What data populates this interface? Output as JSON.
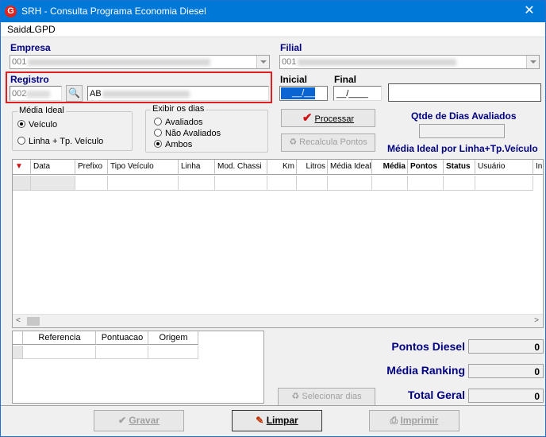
{
  "window": {
    "title": "SRH - Consulta Programa Economia Diesel",
    "close": "✕"
  },
  "menu": [
    "Saida",
    "LGPD"
  ],
  "empresa": {
    "label": "Empresa",
    "code": "001"
  },
  "filial": {
    "label": "Filial",
    "code": "001"
  },
  "registro": {
    "label": "Registro",
    "code": "002",
    "name": "AB"
  },
  "inicial": {
    "label": "Inicial",
    "value": "__/____"
  },
  "final": {
    "label": "Final",
    "value": "__/____"
  },
  "media_ideal": {
    "title": "Média Ideal",
    "options": [
      "Veículo",
      "Linha + Tp. Veículo"
    ],
    "selected": 0
  },
  "exibir": {
    "title": "Exibir os dias",
    "options": [
      "Avaliados",
      "Não Avaliados",
      "Ambos"
    ],
    "selected": 2
  },
  "buttons": {
    "processar": "Processar",
    "recalcula": "Recalcula Pontos",
    "selecionar": "Selecionar dias",
    "gravar": "Gravar",
    "limpar": "Limpar",
    "imprimir": "Imprimir"
  },
  "qtde_label": "Qtde de Dias Avaliados",
  "media_linha_label": "Média Ideal por Linha+Tp.Veículo",
  "grid_columns": [
    "Data",
    "Prefixo",
    "Tipo Veículo",
    "Linha",
    "Mod. Chassi",
    "Km",
    "Litros",
    "Média Ideal",
    "Média",
    "Pontos",
    "Status",
    "Usuário",
    "In"
  ],
  "sub_grid_columns": [
    "Referencia",
    "Pontuacao",
    "Origem"
  ],
  "totals": {
    "pontos_label": "Pontos Diesel",
    "pontos": "0",
    "ranking_label": "Média Ranking",
    "ranking": "0",
    "total_label": "Total Geral",
    "total": "0"
  },
  "colors": {
    "titlebar": "#0078d7",
    "label_blue": "#000080",
    "highlight_red": "#e02020"
  }
}
